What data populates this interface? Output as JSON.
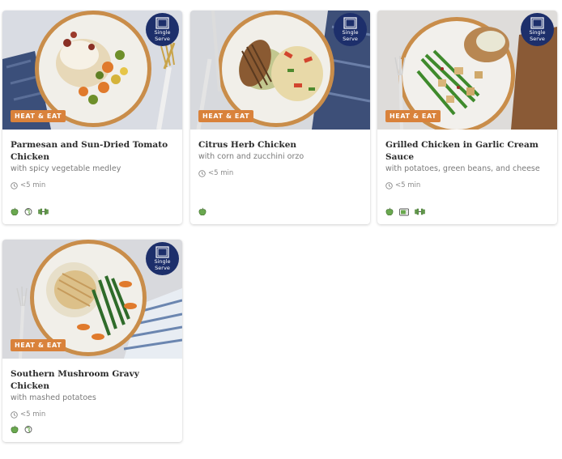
{
  "cards": [
    {
      "badge": "HEAT & EAT",
      "serve_label": [
        "Single",
        "Serve"
      ],
      "title": "Parmesan and Sun-Dried Tomato Chicken",
      "subtitle": "with spicy vegetable medley",
      "time": "<5 min",
      "icons": [
        "apple-icon",
        "carb-icon",
        "protein-dumbbell-icon"
      ]
    },
    {
      "badge": "HEAT & EAT",
      "serve_label": [
        "Single",
        "Serve"
      ],
      "title": "Citrus Herb Chicken",
      "subtitle": "with corn and zucchini orzo",
      "time": "<5 min",
      "icons": [
        "apple-icon"
      ]
    },
    {
      "badge": "HEAT & EAT",
      "serve_label": [
        "Single",
        "Serve"
      ],
      "title": "Grilled Chicken in Garlic Cream Sauce",
      "subtitle": "with potatoes, green beans, and cheese",
      "time": "<5 min",
      "icons": [
        "apple-icon",
        "microwave-icon",
        "protein-dumbbell-icon"
      ]
    },
    {
      "badge": "HEAT & EAT",
      "serve_label": [
        "Single",
        "Serve"
      ],
      "title": "Southern Mushroom Gravy Chicken",
      "subtitle": "with mashed potatoes",
      "time": "<5 min",
      "icons": [
        "apple-icon",
        "carb-icon"
      ]
    }
  ],
  "colors": {
    "badge": "#d9823b",
    "serve_circle": "#1d2f6b",
    "icon_green": "#6aa84f"
  }
}
